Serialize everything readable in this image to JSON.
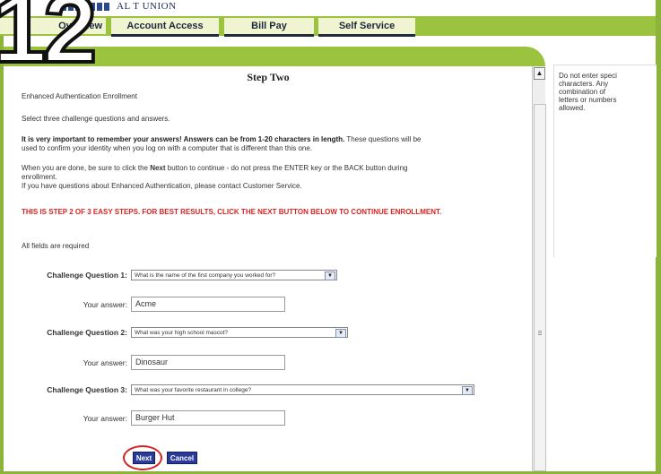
{
  "header": {
    "org_name": "AL         T UNION"
  },
  "overlay": {
    "step_number": "12"
  },
  "nav": {
    "tabs": [
      {
        "label": "Overview"
      },
      {
        "label": "Account Access"
      },
      {
        "label": "Bill Pay"
      },
      {
        "label": "Self Service"
      }
    ]
  },
  "page": {
    "step_title": "Step Two",
    "section_title": "Enhanced Authentication Enrollment",
    "instructions": "Select three challenge questions and answers.",
    "important_bold": "It is very important to remember your answers! Answers can be from 1-20 characters in length.",
    "important_rest": " These questions will be",
    "important_line2": "used to confirm your identity when you log on with a computer that is different than this one.",
    "done_line1a": "When you are done, be sure to click the ",
    "done_next": "Next",
    "done_line1b": " button to continue - do not press the ENTER key or the BACK button during",
    "done_line2": "enrollment.",
    "help_line": "If you have questions about Enhanced Authentication, please contact Customer Service.",
    "warning": "THIS IS STEP 2 OF 3 EASY STEPS. FOR BEST RESULTS, CLICK THE NEXT BUTTON BELOW TO CONTINUE ENROLLMENT.",
    "required_note": "All fields are required"
  },
  "form": {
    "questions": [
      {
        "label": "Challenge Question 1:",
        "selected": "What is the name of the first company you worked for?",
        "answer_label": "Your answer:",
        "answer": "Acme"
      },
      {
        "label": "Challenge Question 2:",
        "selected": "What was your high school mascot?",
        "answer_label": "Your answer:",
        "answer": "Dinosaur"
      },
      {
        "label": "Challenge Question 3:",
        "selected": "What was your favorite restaurant in college?",
        "answer_label": "Your answer:",
        "answer": "Burger Hut"
      }
    ],
    "next_label": "Next",
    "cancel_label": "Cancel"
  },
  "sidebar": {
    "note": "Do not enter speci\ncharacters. Any\ncombination of\nletters or numbers\nallowed."
  },
  "scroll": {
    "up_arrow": "▲"
  },
  "select_arrow": "▼",
  "colors": {
    "nav_green": "#9cc33f",
    "tab_bg": "#f1f4d0",
    "button_blue": "#2a3a9a",
    "warning_red": "#e02020"
  }
}
